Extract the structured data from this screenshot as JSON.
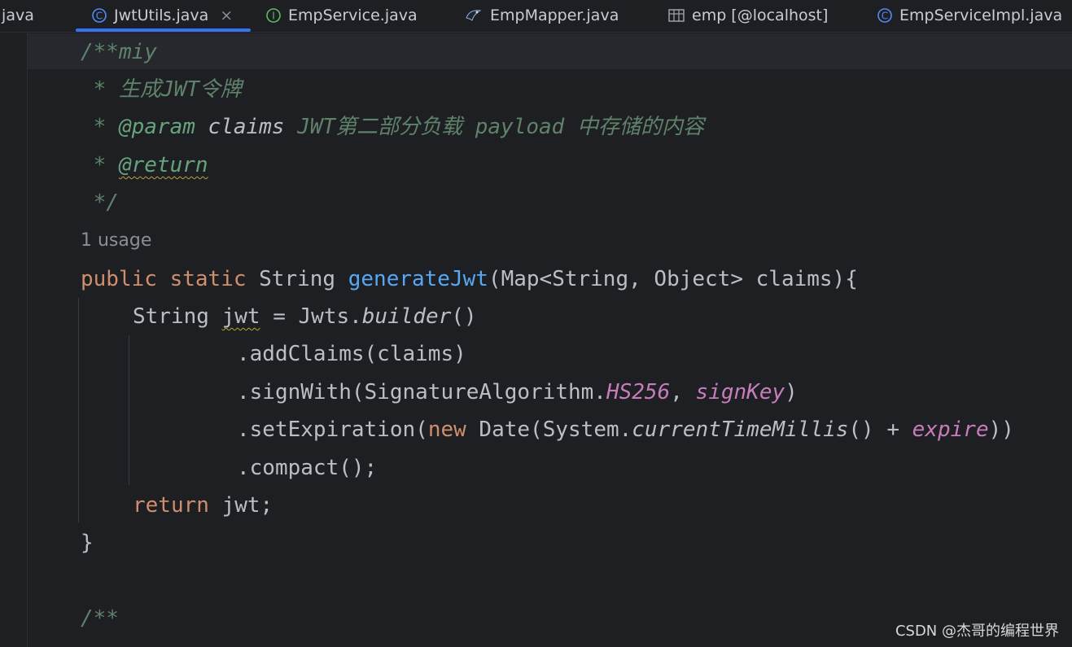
{
  "tabs": [
    {
      "label": ".java",
      "icon": "none",
      "active": false
    },
    {
      "label": "JwtUtils.java",
      "icon": "class-icon",
      "active": true,
      "close": "×"
    },
    {
      "label": "EmpService.java",
      "icon": "interface-icon",
      "active": false
    },
    {
      "label": "EmpMapper.java",
      "icon": "mapper-icon",
      "active": false
    },
    {
      "label": "emp [@localhost]",
      "icon": "table-icon",
      "active": false
    },
    {
      "label": "EmpServiceImpl.java",
      "icon": "class-icon",
      "active": false
    }
  ],
  "code": {
    "doc_open": "/**miy",
    "doc_line1": " * 生成JWT令牌",
    "doc_line2_star": " * ",
    "doc_param_tag": "@param",
    "doc_param_name": " claims",
    "doc_param_desc": " JWT第二部分负载 payload 中存储的内容",
    "doc_line3_star": " * ",
    "doc_return_tag": "@return",
    "doc_close": " */",
    "usage_hint": "1 usage",
    "sig_public": "public",
    "sig_static": "static",
    "sig_type": "String",
    "sig_method": "generateJwt",
    "sig_params": "(Map<String, Object> claims){",
    "l1_type": "String",
    "l1_var": "jwt",
    "l1_eq": " = Jwts.",
    "l1_builder": "builder",
    "l1_tail": "()",
    "l2": ".addClaims(claims)",
    "l3_a": ".signWith(SignatureAlgorithm.",
    "l3_hs": "HS256",
    "l3_comma": ", ",
    "l3_key": "signKey",
    "l3_end": ")",
    "l4_a": ".setExpiration(",
    "l4_new": "new",
    "l4_b": " Date(System.",
    "l4_ctm": "currentTimeMillis",
    "l4_c": "() + ",
    "l4_expire": "expire",
    "l4_end": "))",
    "l5": ".compact();",
    "ret_kw": "return",
    "ret_val": " jwt;",
    "close_brace": "}",
    "next_doc": "/**"
  },
  "watermark": "CSDN @杰哥的编程世界",
  "colors": {
    "background": "#1e1f22",
    "keyword": "#cf8e6d",
    "method": "#56a8f5",
    "field": "#c77dbb",
    "comment": "#5f826b",
    "accent": "#3574f0"
  }
}
